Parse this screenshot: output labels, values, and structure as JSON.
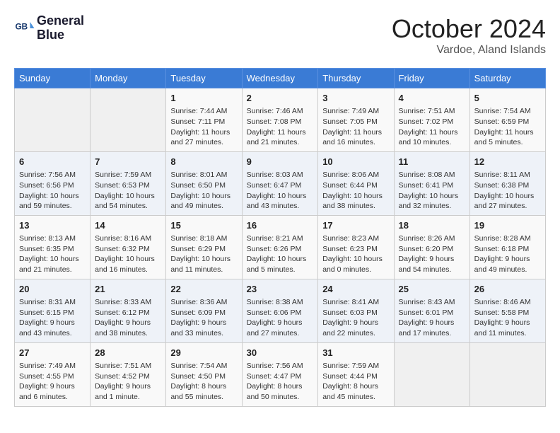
{
  "header": {
    "logo_line1": "General",
    "logo_line2": "Blue",
    "month": "October 2024",
    "location": "Vardoe, Aland Islands"
  },
  "weekdays": [
    "Sunday",
    "Monday",
    "Tuesday",
    "Wednesday",
    "Thursday",
    "Friday",
    "Saturday"
  ],
  "weeks": [
    [
      {
        "day": "",
        "detail": ""
      },
      {
        "day": "",
        "detail": ""
      },
      {
        "day": "1",
        "detail": "Sunrise: 7:44 AM\nSunset: 7:11 PM\nDaylight: 11 hours and 27 minutes."
      },
      {
        "day": "2",
        "detail": "Sunrise: 7:46 AM\nSunset: 7:08 PM\nDaylight: 11 hours and 21 minutes."
      },
      {
        "day": "3",
        "detail": "Sunrise: 7:49 AM\nSunset: 7:05 PM\nDaylight: 11 hours and 16 minutes."
      },
      {
        "day": "4",
        "detail": "Sunrise: 7:51 AM\nSunset: 7:02 PM\nDaylight: 11 hours and 10 minutes."
      },
      {
        "day": "5",
        "detail": "Sunrise: 7:54 AM\nSunset: 6:59 PM\nDaylight: 11 hours and 5 minutes."
      }
    ],
    [
      {
        "day": "6",
        "detail": "Sunrise: 7:56 AM\nSunset: 6:56 PM\nDaylight: 10 hours and 59 minutes."
      },
      {
        "day": "7",
        "detail": "Sunrise: 7:59 AM\nSunset: 6:53 PM\nDaylight: 10 hours and 54 minutes."
      },
      {
        "day": "8",
        "detail": "Sunrise: 8:01 AM\nSunset: 6:50 PM\nDaylight: 10 hours and 49 minutes."
      },
      {
        "day": "9",
        "detail": "Sunrise: 8:03 AM\nSunset: 6:47 PM\nDaylight: 10 hours and 43 minutes."
      },
      {
        "day": "10",
        "detail": "Sunrise: 8:06 AM\nSunset: 6:44 PM\nDaylight: 10 hours and 38 minutes."
      },
      {
        "day": "11",
        "detail": "Sunrise: 8:08 AM\nSunset: 6:41 PM\nDaylight: 10 hours and 32 minutes."
      },
      {
        "day": "12",
        "detail": "Sunrise: 8:11 AM\nSunset: 6:38 PM\nDaylight: 10 hours and 27 minutes."
      }
    ],
    [
      {
        "day": "13",
        "detail": "Sunrise: 8:13 AM\nSunset: 6:35 PM\nDaylight: 10 hours and 21 minutes."
      },
      {
        "day": "14",
        "detail": "Sunrise: 8:16 AM\nSunset: 6:32 PM\nDaylight: 10 hours and 16 minutes."
      },
      {
        "day": "15",
        "detail": "Sunrise: 8:18 AM\nSunset: 6:29 PM\nDaylight: 10 hours and 11 minutes."
      },
      {
        "day": "16",
        "detail": "Sunrise: 8:21 AM\nSunset: 6:26 PM\nDaylight: 10 hours and 5 minutes."
      },
      {
        "day": "17",
        "detail": "Sunrise: 8:23 AM\nSunset: 6:23 PM\nDaylight: 10 hours and 0 minutes."
      },
      {
        "day": "18",
        "detail": "Sunrise: 8:26 AM\nSunset: 6:20 PM\nDaylight: 9 hours and 54 minutes."
      },
      {
        "day": "19",
        "detail": "Sunrise: 8:28 AM\nSunset: 6:18 PM\nDaylight: 9 hours and 49 minutes."
      }
    ],
    [
      {
        "day": "20",
        "detail": "Sunrise: 8:31 AM\nSunset: 6:15 PM\nDaylight: 9 hours and 43 minutes."
      },
      {
        "day": "21",
        "detail": "Sunrise: 8:33 AM\nSunset: 6:12 PM\nDaylight: 9 hours and 38 minutes."
      },
      {
        "day": "22",
        "detail": "Sunrise: 8:36 AM\nSunset: 6:09 PM\nDaylight: 9 hours and 33 minutes."
      },
      {
        "day": "23",
        "detail": "Sunrise: 8:38 AM\nSunset: 6:06 PM\nDaylight: 9 hours and 27 minutes."
      },
      {
        "day": "24",
        "detail": "Sunrise: 8:41 AM\nSunset: 6:03 PM\nDaylight: 9 hours and 22 minutes."
      },
      {
        "day": "25",
        "detail": "Sunrise: 8:43 AM\nSunset: 6:01 PM\nDaylight: 9 hours and 17 minutes."
      },
      {
        "day": "26",
        "detail": "Sunrise: 8:46 AM\nSunset: 5:58 PM\nDaylight: 9 hours and 11 minutes."
      }
    ],
    [
      {
        "day": "27",
        "detail": "Sunrise: 7:49 AM\nSunset: 4:55 PM\nDaylight: 9 hours and 6 minutes."
      },
      {
        "day": "28",
        "detail": "Sunrise: 7:51 AM\nSunset: 4:52 PM\nDaylight: 9 hours and 1 minute."
      },
      {
        "day": "29",
        "detail": "Sunrise: 7:54 AM\nSunset: 4:50 PM\nDaylight: 8 hours and 55 minutes."
      },
      {
        "day": "30",
        "detail": "Sunrise: 7:56 AM\nSunset: 4:47 PM\nDaylight: 8 hours and 50 minutes."
      },
      {
        "day": "31",
        "detail": "Sunrise: 7:59 AM\nSunset: 4:44 PM\nDaylight: 8 hours and 45 minutes."
      },
      {
        "day": "",
        "detail": ""
      },
      {
        "day": "",
        "detail": ""
      }
    ]
  ]
}
